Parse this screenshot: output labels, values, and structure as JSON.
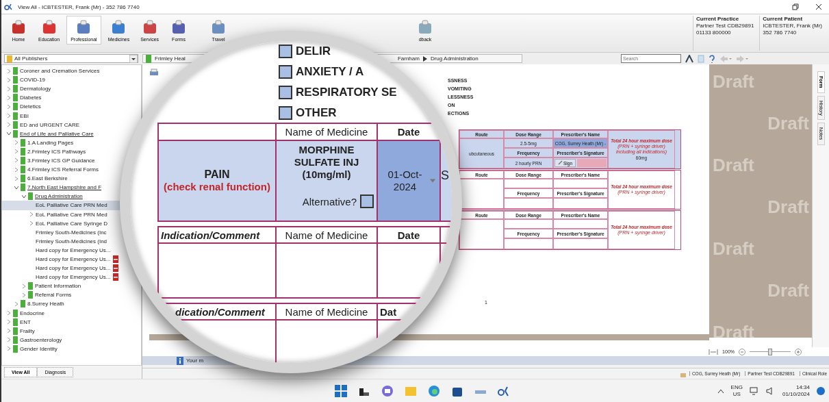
{
  "window": {
    "title": "View All  -  ICBTESTER, Frank (Mr)  -  352 786 7740"
  },
  "ribbon": [
    {
      "label": "Home",
      "selected": false
    },
    {
      "label": "Education",
      "selected": false
    },
    {
      "label": "Professional",
      "selected": true
    },
    {
      "label": "Medicines",
      "selected": false
    },
    {
      "label": "Services",
      "selected": false
    },
    {
      "label": "Forms",
      "selected": false
    },
    {
      "label": "Travel",
      "selected": false
    },
    {
      "label": "dback",
      "selected": false
    }
  ],
  "current_practice": {
    "heading": "Current Practice",
    "name": "Partner Test CDB29891",
    "phone": "01133 800000"
  },
  "current_patient": {
    "heading": "Current Patient",
    "name": "ICBTESTER, Frank (Mr)",
    "phone": "352 786 7740"
  },
  "publisher_select": {
    "value": "All Publishers"
  },
  "breadcrumb": [
    "Frimley Heal",
    "Farnham",
    "Drug Administration"
  ],
  "search": {
    "placeholder": "Search"
  },
  "tree": [
    {
      "label": "Coroner and Cremation Services",
      "kind": "folder",
      "expanded": false,
      "selected": false
    },
    {
      "label": "COVID-19",
      "kind": "folder",
      "expanded": false,
      "selected": false
    },
    {
      "label": "Dermatology",
      "kind": "folder",
      "expanded": false,
      "selected": false
    },
    {
      "label": "Diabetes",
      "kind": "folder",
      "expanded": false,
      "selected": false
    },
    {
      "label": "Dietetics",
      "kind": "folder",
      "expanded": false,
      "selected": false
    },
    {
      "label": "EBI",
      "kind": "folder",
      "expanded": false,
      "selected": false
    },
    {
      "label": "ED and URGENT CARE",
      "kind": "folder",
      "expanded": false,
      "selected": false
    },
    {
      "label": "End of Life and Palliative Care",
      "kind": "folder",
      "expanded": true,
      "selected": false,
      "children": [
        {
          "label": "1.A Landing Pages",
          "kind": "folder",
          "expanded": false,
          "selected": false
        },
        {
          "label": "2.Frimley ICS Pathways",
          "kind": "folder",
          "expanded": false,
          "selected": false
        },
        {
          "label": "3.Frimley ICS GP Guidance",
          "kind": "folder",
          "expanded": false,
          "selected": false
        },
        {
          "label": "4.Frimley ICS Referral Forms",
          "kind": "folder",
          "expanded": false,
          "selected": false
        },
        {
          "label": "6.East Berkshire",
          "kind": "folder",
          "expanded": false,
          "selected": false
        },
        {
          "label": "7.North East Hampshire and F",
          "kind": "folder",
          "expanded": true,
          "selected": false,
          "children": [
            {
              "label": "Drug Administration",
              "kind": "folder",
              "expanded": true,
              "selected": false,
              "children": [
                {
                  "label": "EoL Palliative Care PRN Med",
                  "kind": "page",
                  "selected": true
                },
                {
                  "label": "EoL Palliative Care PRN Med",
                  "kind": "page",
                  "expanded": false,
                  "selected": false
                },
                {
                  "label": "EoL Palliative Care Syringe D",
                  "kind": "page",
                  "expanded": false,
                  "selected": false
                },
                {
                  "label": "Frimley South-Medicines (Inc",
                  "kind": "page",
                  "selected": false
                },
                {
                  "label": "Frimley South-Medicines (Ind",
                  "kind": "page",
                  "selected": false
                },
                {
                  "label": "Hard copy for Emergency Us...",
                  "kind": "page",
                  "selected": false
                },
                {
                  "label": "Hard copy for Emergency Us...",
                  "kind": "pdf",
                  "selected": false
                },
                {
                  "label": "Hard copy for Emergency Us...",
                  "kind": "pdf",
                  "selected": false
                },
                {
                  "label": "Hard copy for Emergency Us...",
                  "kind": "pdf",
                  "selected": false
                }
              ]
            },
            {
              "label": "Patient Information",
              "kind": "folder",
              "expanded": false,
              "selected": false
            },
            {
              "label": "Referral Forms",
              "kind": "folder",
              "expanded": false,
              "selected": false
            }
          ]
        },
        {
          "label": "8.Surrey Heath",
          "kind": "folder",
          "expanded": false,
          "selected": false
        }
      ]
    },
    {
      "label": "Endocrine",
      "kind": "folder",
      "expanded": false,
      "selected": false
    },
    {
      "label": "ENT",
      "kind": "folder",
      "expanded": false,
      "selected": false
    },
    {
      "label": "Frailty",
      "kind": "folder",
      "expanded": false,
      "selected": false
    },
    {
      "label": "Gastroenterology",
      "kind": "folder",
      "expanded": false,
      "selected": false
    },
    {
      "label": "Gender Identity",
      "kind": "folder",
      "expanded": false,
      "selected": false
    }
  ],
  "left_tabs": [
    {
      "label": "View All",
      "selected": true
    },
    {
      "label": "Diagnosis",
      "selected": false
    }
  ],
  "form_labels": [
    "SSNESS",
    "VOMITING",
    "LESSNESS",
    "ON",
    "ECTIONS"
  ],
  "dose_tables": [
    {
      "filled": true,
      "route_header": "Route",
      "dose_header": "Dose Range",
      "name_header": "Prescriber's Name",
      "max_header": "Total 24 hour maximum dose",
      "max_note": "(PRN + syringe driver) including all indications)",
      "route": "ubcutaneous",
      "dose": "2.5-5mg",
      "prescriber": "COG, Surrey Heath (Mr) -",
      "freq_header": "Frequency",
      "sig_header": "Prescriber's Signature",
      "frequency": "2 hourly PRN",
      "sign_button": "Sign",
      "max_value": "60mg"
    },
    {
      "filled": false,
      "route_header": "Route",
      "dose_header": "Dose Range",
      "name_header": "Prescriber's Name",
      "max_header": "Total 24 hour maximum dose",
      "max_note": "(PRN + syringe driver)",
      "freq_header": "Frequency",
      "sig_header": "Prescriber's Signature"
    },
    {
      "filled": false,
      "route_header": "Route",
      "dose_header": "Dose Range",
      "name_header": "Prescriber's Name",
      "max_header": "Total 24 hour maximum dose",
      "max_note": "(PRN + syringe driver)",
      "freq_header": "Frequency",
      "sig_header": "Prescriber's Signature"
    }
  ],
  "page_number": "1",
  "watermarks": [
    "Draft",
    "Draft",
    "Draft",
    "Draft",
    "Draft",
    "Draft",
    "Draft"
  ],
  "side_tabs": [
    {
      "label": "Form",
      "selected": true
    },
    {
      "label": "History",
      "selected": false
    },
    {
      "label": "Notes",
      "selected": false
    }
  ],
  "zoom": {
    "label": "100%",
    "level": 0.5
  },
  "info_bar": {
    "text": "Your m"
  },
  "status_bar": [
    "COG, Surrey Heath (Mr)",
    "Partner Test CDB29891",
    "Clinical Role"
  ],
  "magnifier": {
    "checkboxes": [
      {
        "label": "DELIR",
        "checked": false
      },
      {
        "label": "ANXIETY / A",
        "checked": false
      },
      {
        "label": "RESPIRATORY SE",
        "checked": false
      },
      {
        "label": "OTHER",
        "checked": false
      }
    ],
    "header_medicine": "Name of Medicine",
    "header_date": "Date",
    "section": "PAIN",
    "section_note": "(check renal function)",
    "medicine": "MORPHINE SULFATE INJ (10mg/ml)",
    "date": "01-Oct-2024",
    "alternative": {
      "label": "Alternative?",
      "checked": false
    },
    "route_partial": "S",
    "comment_tables": [
      [
        "Indication/Comment",
        "Name of Medicine",
        "Date"
      ],
      [
        "dication/Comment",
        "Name of Medicine",
        "Dat"
      ]
    ]
  },
  "taskbar": {
    "language": "ENG",
    "region": "US",
    "time": "14:34",
    "date": "01/10/2024"
  }
}
